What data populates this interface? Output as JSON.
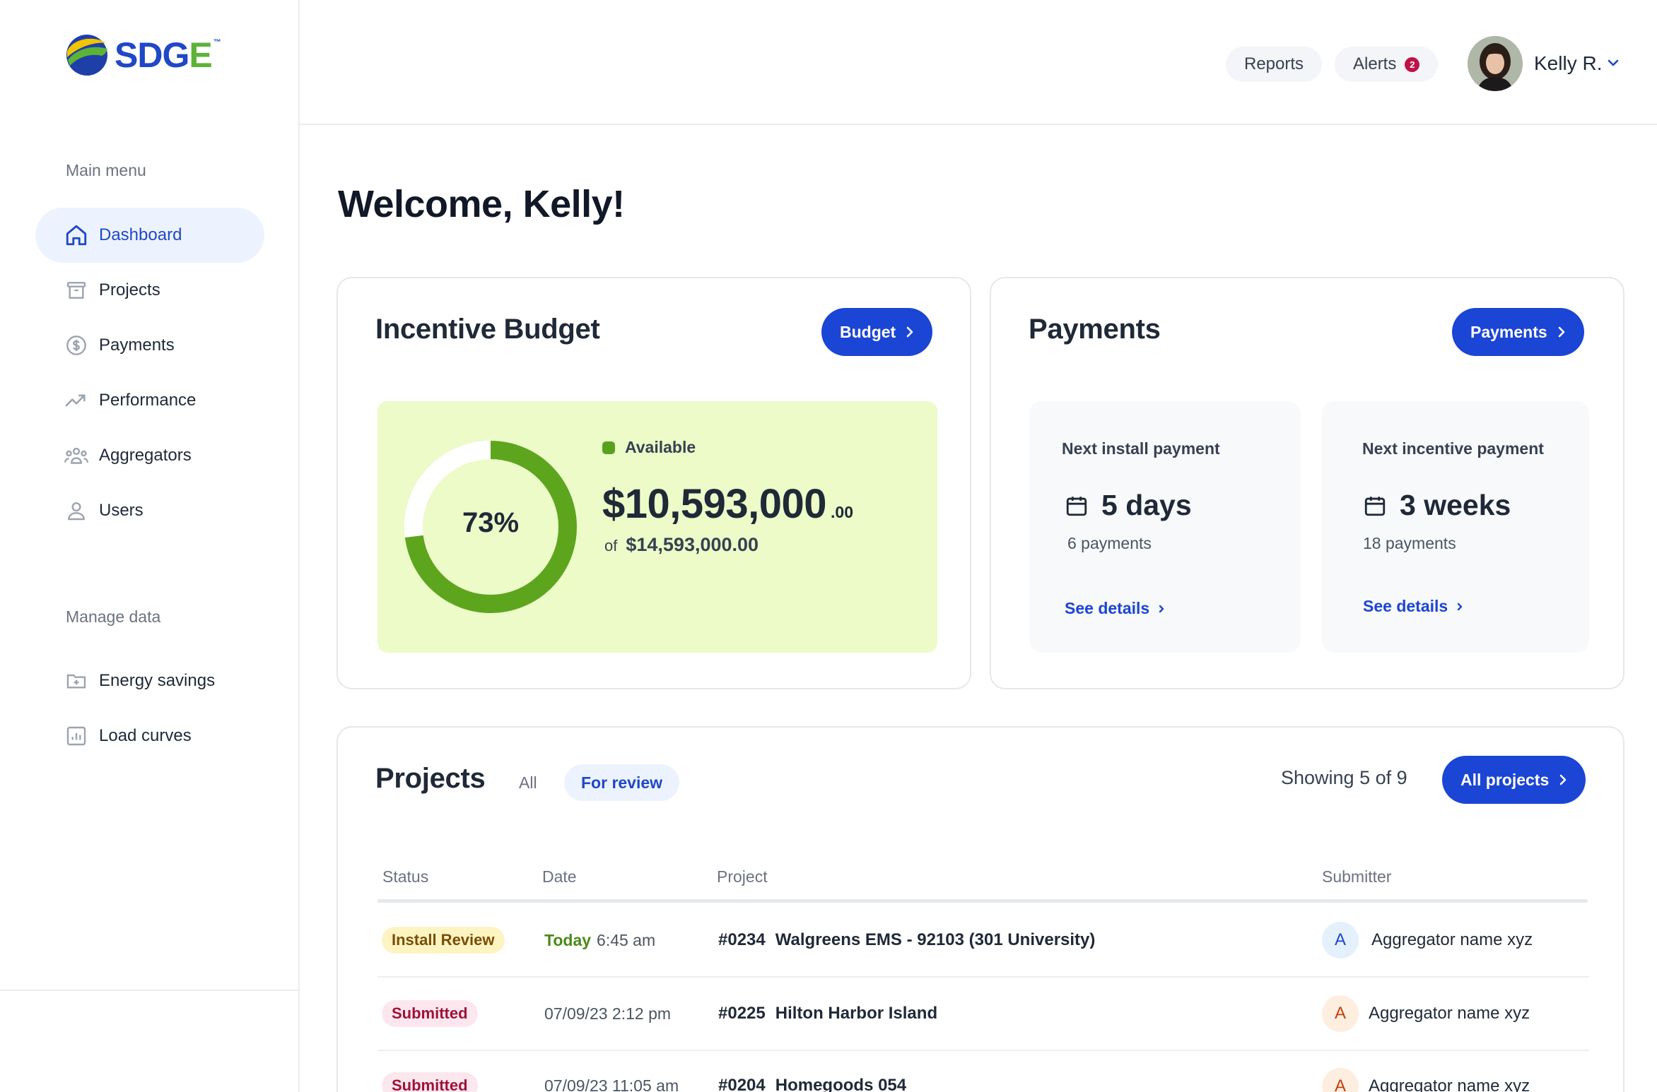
{
  "brand": {
    "name_s": "SDG",
    "name_e": "E",
    "trademark": "™"
  },
  "sidebar": {
    "main_heading": "Main menu",
    "main_items": [
      {
        "label": "Dashboard",
        "icon": "home-icon",
        "active": true
      },
      {
        "label": "Projects",
        "icon": "archive-icon"
      },
      {
        "label": "Payments",
        "icon": "dollar-circle-icon"
      },
      {
        "label": "Performance",
        "icon": "trend-up-icon"
      },
      {
        "label": "Aggregators",
        "icon": "people-group-icon"
      },
      {
        "label": "Users",
        "icon": "user-icon"
      }
    ],
    "data_heading": "Manage data",
    "data_items": [
      {
        "label": "Energy savings",
        "icon": "folder-plus-icon"
      },
      {
        "label": "Load curves",
        "icon": "bar-chart-icon"
      }
    ]
  },
  "topbar": {
    "reports_label": "Reports",
    "alerts_label": "Alerts",
    "alerts_count": "2",
    "user_name": "Kelly R."
  },
  "welcome": "Welcome, Kelly!",
  "budget": {
    "title": "Incentive Budget",
    "button_label": "Budget",
    "percent": 73,
    "percent_label": "73%",
    "available_label": "Available",
    "amount": "$10,593,000",
    "cents": ".00",
    "of_label": "of",
    "total": "$14,593,000.00",
    "colors": {
      "fill": "#5ea51e",
      "panel": "#ecfbc8"
    }
  },
  "payments": {
    "title": "Payments",
    "button_label": "Payments",
    "install": {
      "label": "Next install payment",
      "value": "5 days",
      "sub": "6 payments",
      "link": "See details"
    },
    "incentive": {
      "label": "Next incentive payment",
      "value": "3 weeks",
      "sub": "18 payments",
      "link": "See details"
    }
  },
  "projects": {
    "title": "Projects",
    "tabs": {
      "all": "All",
      "review": "For review"
    },
    "showing": "Showing 5 of 9",
    "button_label": "All projects",
    "columns": {
      "status": "Status",
      "date": "Date",
      "project": "Project",
      "submitter": "Submitter"
    },
    "rows": [
      {
        "status": "Install Review",
        "date_today": "Today",
        "date": "6:45 am",
        "num": "#0234",
        "name": "Walgreens EMS - 92103 (301 University)",
        "initial": "A",
        "submitter": "Aggregator name xyz"
      },
      {
        "status": "Submitted",
        "date": "07/09/23 2:12 pm",
        "num": "#0225",
        "name": "Hilton Harbor Island",
        "initial": "A",
        "submitter": "Aggregator name xyz"
      },
      {
        "status": "Submitted",
        "date": "07/09/23 11:05 am",
        "num": "#0204",
        "name": "Homegoods 054",
        "initial": "A",
        "submitter": "Aggregator name xyz"
      }
    ]
  },
  "accent_color": "#1b45d4"
}
